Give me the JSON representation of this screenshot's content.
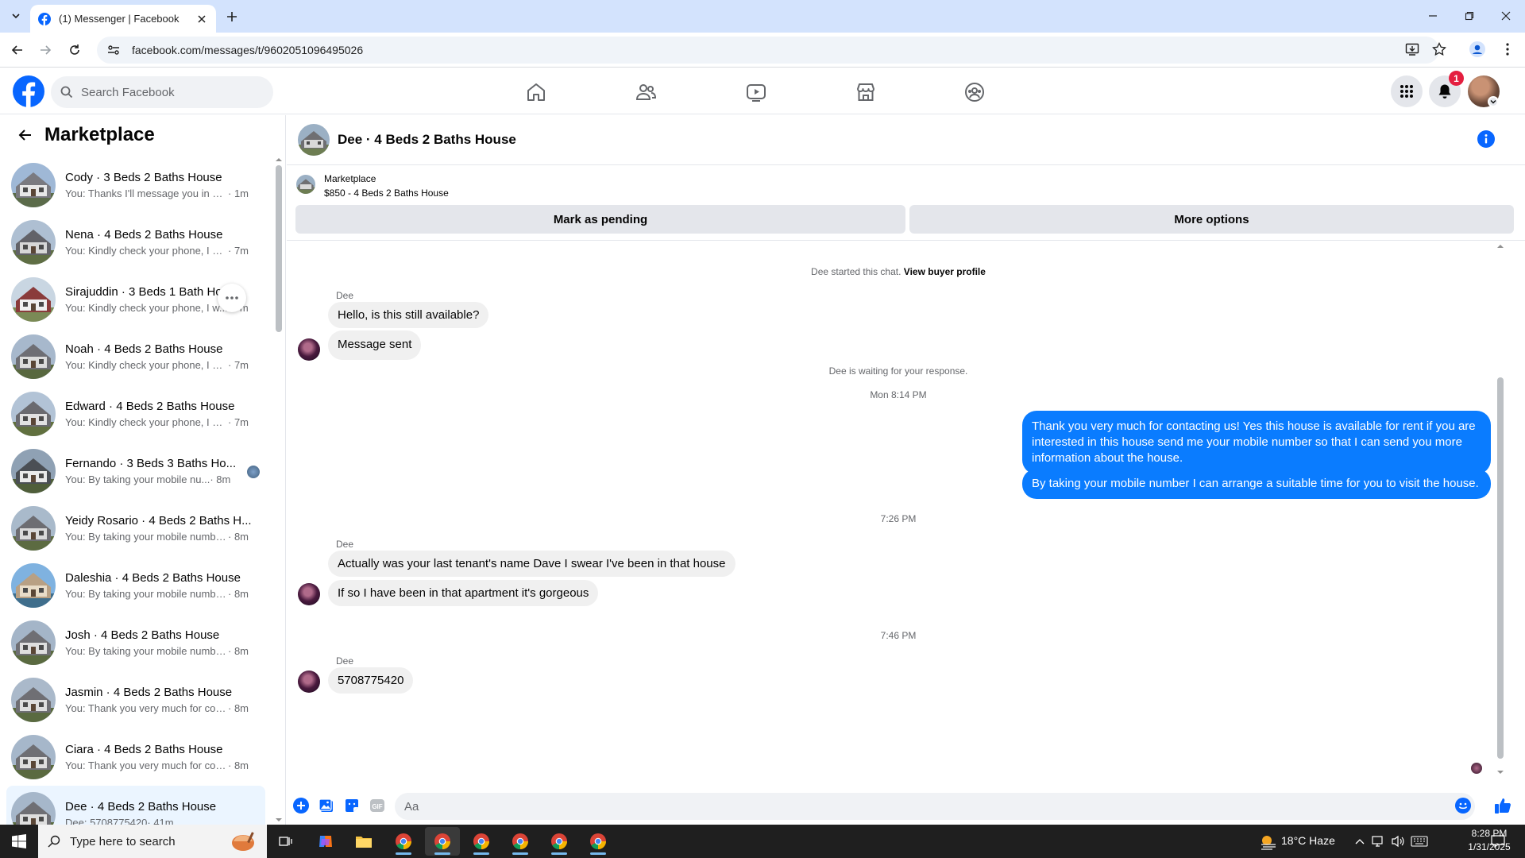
{
  "browser": {
    "tab_title": "(1) Messenger | Facebook",
    "url": "facebook.com/messages/t/9602051096495026"
  },
  "fb": {
    "search_placeholder": "Search Facebook",
    "notification_count": "1"
  },
  "sidebar": {
    "title": "Marketplace",
    "conversations": [
      {
        "name": "Cody · 3 Beds 2 Baths House",
        "preview": "You: Thanks I'll message you in a ...",
        "time": " · 1m"
      },
      {
        "name": "Nena · 4 Beds 2 Baths House",
        "preview": "You: Kindly check your phone, I wi...",
        "time": " · 7m"
      },
      {
        "name": "Sirajuddin · 3 Beds 1 Bath Ho...",
        "preview": "You: Kindly check your phone, I w...",
        "time": " · 7m"
      },
      {
        "name": "Noah · 4 Beds 2 Baths House",
        "preview": "You: Kindly check your phone, I wi...",
        "time": " · 7m"
      },
      {
        "name": "Edward · 4 Beds 2 Baths House",
        "preview": "You: Kindly check your phone, I wi...",
        "time": " · 7m"
      },
      {
        "name": "Fernando · 3 Beds 3 Baths Ho...",
        "preview": "You: By taking your mobile nu...",
        "time": " · 8m"
      },
      {
        "name": "Yeidy Rosario · 4 Beds 2 Baths H...",
        "preview": "You: By taking your mobile numbe...",
        "time": " · 8m"
      },
      {
        "name": "Daleshia · 4 Beds 2 Baths House",
        "preview": "You: By taking your mobile numbe...",
        "time": " · 8m"
      },
      {
        "name": "Josh · 4 Beds 2 Baths House",
        "preview": "You: By taking your mobile numbe...",
        "time": " · 8m"
      },
      {
        "name": "Jasmin · 4 Beds 2 Baths House",
        "preview": "You: Thank you very much for cont...",
        "time": " · 8m"
      },
      {
        "name": "Ciara · 4 Beds 2 Baths House",
        "preview": "You: Thank you very much for cont...",
        "time": " · 8m"
      },
      {
        "name": "Dee · 4 Beds 2 Baths House",
        "preview": "Dee: 5708775420",
        "time": " · 41m"
      }
    ]
  },
  "chat": {
    "title": "Dee · 4 Beds 2 Baths House",
    "marketplace_label": "Marketplace",
    "listing": "$850 - 4 Beds 2 Baths House",
    "mark_pending": "Mark as pending",
    "more_options": "More options",
    "started_text": "Dee started this chat.",
    "view_profile": "View buyer profile",
    "sender_name": "Dee",
    "msg1": "Hello, is this still available?",
    "msg2": "Message sent",
    "waiting_text": "Dee is waiting for your response.",
    "ts1": "Mon 8:14 PM",
    "out1": "Thank you very much for contacting us! Yes this house is available for rent if you are interested in this house send me your mobile number so that I can send you more information about the house.",
    "out2": "By taking your mobile number I can arrange a suitable time for you to visit the house.",
    "ts2": "7:26 PM",
    "msg3": "Actually was your last tenant's name Dave I swear I've been in that house",
    "msg4": "If so I have been in that apartment it's gorgeous",
    "ts3": "7:46 PM",
    "msg5": "5708775420",
    "composer_placeholder": "Aa"
  },
  "taskbar": {
    "search_placeholder": "Type here to search",
    "weather": "18°C  Haze",
    "time": "8:28 PM",
    "date": "1/31/2025"
  },
  "colors": {
    "fb_blue": "#0866ff",
    "bubble_out": "#0a7cff",
    "bubble_in": "#f0f0f0",
    "active_conv": "#ebf5ff"
  }
}
